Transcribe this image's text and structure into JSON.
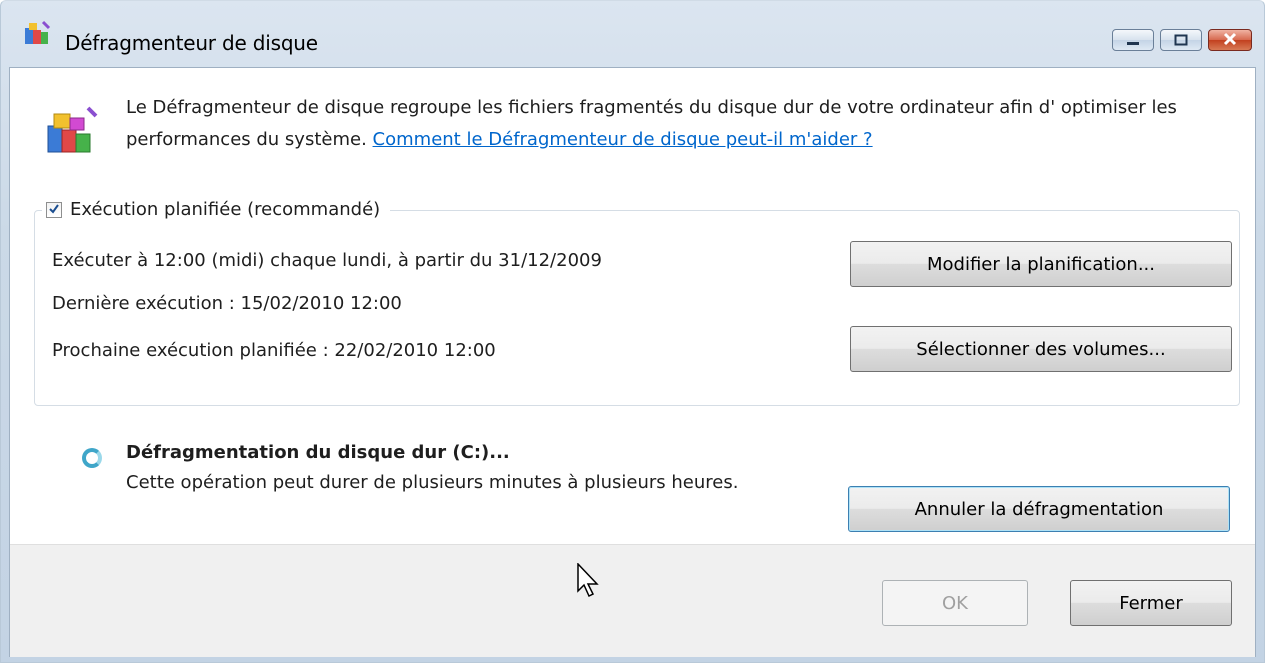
{
  "window": {
    "title": "Défragmenteur de disque",
    "icon": "defrag-app-icon",
    "caption_buttons": [
      "minimize-icon",
      "maximize-icon",
      "close-icon"
    ]
  },
  "intro": {
    "text": "Le Défragmenteur de disque regroupe les fichiers fragmentés du disque dur de votre ordinateur afin d' optimiser les performances du système.",
    "link": "Comment le Défragmenteur de disque peut-il m'aider ?"
  },
  "schedule": {
    "checkbox_label": "Exécution planifiée (recommandé)",
    "checked": true,
    "run_at": "Exécuter à 12:00 (midi) chaque lundi, à partir du 31/12/2009",
    "last_run": "Dernière exécution : 15/02/2010 12:00",
    "next_run": "Prochaine exécution planifiée : 22/02/2010 12:00",
    "modify_button": "Modifier la planification...",
    "select_button": "Sélectionner des volumes..."
  },
  "operation": {
    "title": "Défragmentation du disque dur (C:)...",
    "description": "Cette opération peut durer de plusieurs minutes à plusieurs heures.",
    "cancel_button": "Annuler la défragmentation"
  },
  "footer": {
    "ok_button": "OK",
    "close_button": "Fermer"
  },
  "colors": {
    "link": "#0066cc",
    "spinner": "#3fa6c9",
    "close_button": "#c2401f"
  }
}
